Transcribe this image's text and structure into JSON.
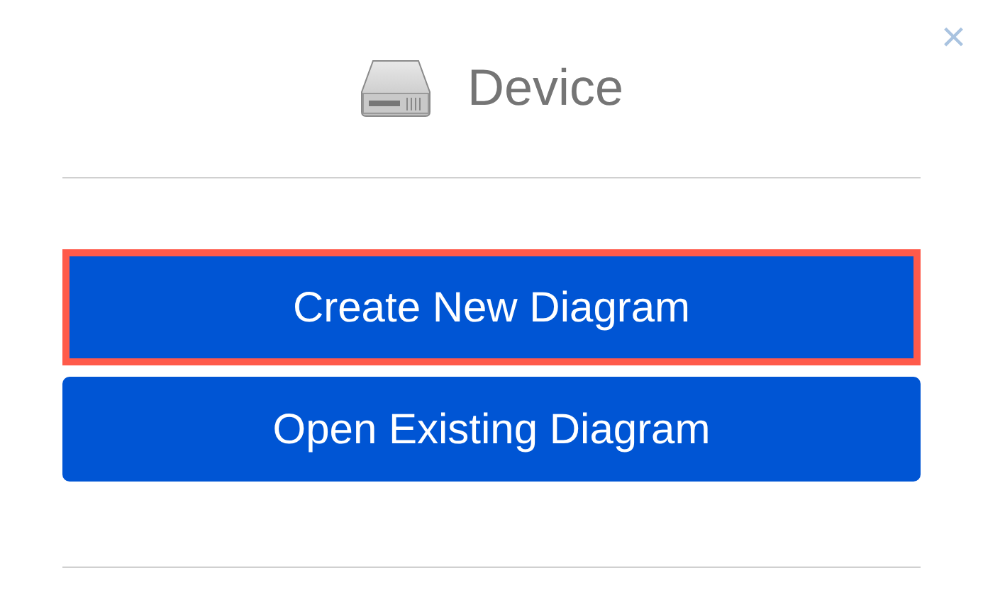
{
  "dialog": {
    "title": "Device",
    "close_label": "×"
  },
  "buttons": [
    {
      "label": "Create New Diagram",
      "selected": true
    },
    {
      "label": "Open Existing Diagram",
      "selected": false
    }
  ]
}
